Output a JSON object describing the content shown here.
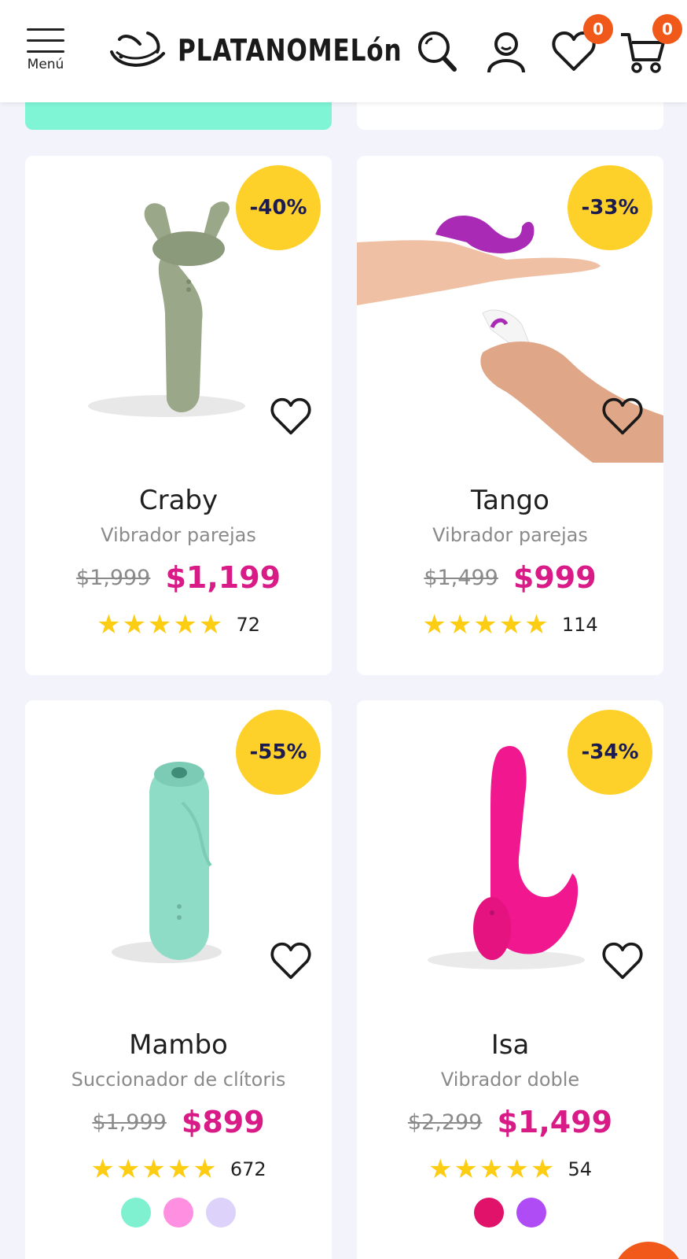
{
  "header": {
    "menu_label": "Menú",
    "brand": "PLATANOMELón",
    "wishlist_count": "0",
    "cart_count": "0"
  },
  "products": [
    {
      "name": "Craby",
      "subtitle": "Vibrador parejas",
      "discount": "-40%",
      "old_price": "$1,999",
      "price": "$1,199",
      "rating_count": "72",
      "stars": "★★★★★"
    },
    {
      "name": "Tango",
      "subtitle": "Vibrador parejas",
      "discount": "-33%",
      "old_price": "$1,499",
      "price": "$999",
      "rating_count": "114",
      "stars": "★★★★★"
    },
    {
      "name": "Mambo",
      "subtitle": "Succionador de clítoris",
      "discount": "-55%",
      "old_price": "$1,999",
      "price": "$899",
      "rating_count": "672",
      "stars": "★★★★★",
      "colors": [
        "#7ff0d0",
        "#ff8fe0",
        "#dcd2fa"
      ]
    },
    {
      "name": "Isa",
      "subtitle": "Vibrador doble",
      "discount": "-34%",
      "old_price": "$2,299",
      "price": "$1,499",
      "rating_count": "54",
      "stars": "★★★★★",
      "colors": [
        "#e0126a",
        "#b04cf5"
      ]
    }
  ],
  "colors": {
    "accent_price": "#d81b86",
    "discount_bg": "#fdd12a",
    "badge": "#f0591a",
    "star": "#fdcd14"
  }
}
